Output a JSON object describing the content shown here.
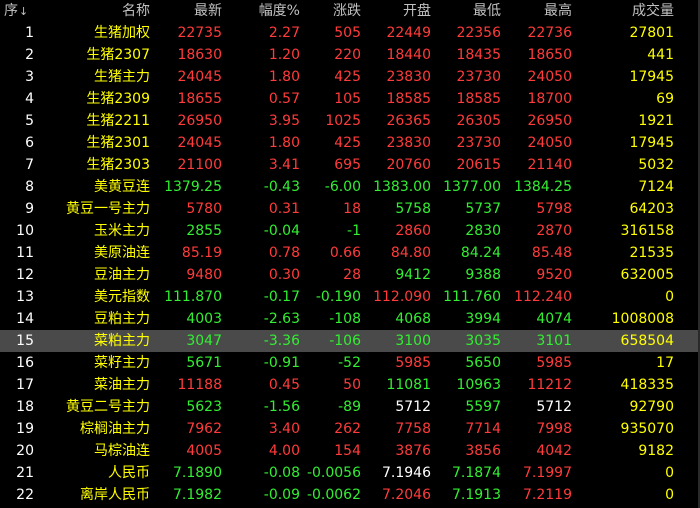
{
  "header": {
    "columns": [
      "序",
      "名称",
      "最新",
      "幅度%",
      "涨跌",
      "开盘",
      "最低",
      "最高",
      "成交量"
    ],
    "sort_arrow": "↓"
  },
  "colors": {
    "up": "#ff3b3b",
    "down": "#33ee33",
    "flat": "#ffffff",
    "name": "#ffff00",
    "volume": "#ffff00",
    "selected_row_bg": "#4a4a4a"
  },
  "selected_index": 14,
  "rows": [
    {
      "n": "1",
      "name": "生猪加权",
      "last": "22735",
      "pct": "2.27",
      "chg": "505",
      "open": "22449",
      "low": "22356",
      "high": "22736",
      "vol": "27801",
      "dir": {
        "last": "up",
        "pct": "up",
        "chg": "up",
        "open": "up",
        "low": "up",
        "high": "up"
      }
    },
    {
      "n": "2",
      "name": "生猪2307",
      "last": "18630",
      "pct": "1.20",
      "chg": "220",
      "open": "18440",
      "low": "18435",
      "high": "18650",
      "vol": "441",
      "dir": {
        "last": "up",
        "pct": "up",
        "chg": "up",
        "open": "up",
        "low": "up",
        "high": "up"
      }
    },
    {
      "n": "3",
      "name": "生猪主力",
      "last": "24045",
      "pct": "1.80",
      "chg": "425",
      "open": "23830",
      "low": "23730",
      "high": "24050",
      "vol": "17945",
      "dir": {
        "last": "up",
        "pct": "up",
        "chg": "up",
        "open": "up",
        "low": "up",
        "high": "up"
      }
    },
    {
      "n": "4",
      "name": "生猪2309",
      "last": "18655",
      "pct": "0.57",
      "chg": "105",
      "open": "18585",
      "low": "18585",
      "high": "18700",
      "vol": "69",
      "dir": {
        "last": "up",
        "pct": "up",
        "chg": "up",
        "open": "up",
        "low": "up",
        "high": "up"
      }
    },
    {
      "n": "5",
      "name": "生猪2211",
      "last": "26950",
      "pct": "3.95",
      "chg": "1025",
      "open": "26365",
      "low": "26305",
      "high": "26950",
      "vol": "1921",
      "dir": {
        "last": "up",
        "pct": "up",
        "chg": "up",
        "open": "up",
        "low": "up",
        "high": "up"
      }
    },
    {
      "n": "6",
      "name": "生猪2301",
      "last": "24045",
      "pct": "1.80",
      "chg": "425",
      "open": "23830",
      "low": "23730",
      "high": "24050",
      "vol": "17945",
      "dir": {
        "last": "up",
        "pct": "up",
        "chg": "up",
        "open": "up",
        "low": "up",
        "high": "up"
      }
    },
    {
      "n": "7",
      "name": "生猪2303",
      "last": "21100",
      "pct": "3.41",
      "chg": "695",
      "open": "20760",
      "low": "20615",
      "high": "21140",
      "vol": "5032",
      "dir": {
        "last": "up",
        "pct": "up",
        "chg": "up",
        "open": "up",
        "low": "up",
        "high": "up"
      }
    },
    {
      "n": "8",
      "name": "美黄豆连",
      "last": "1379.25",
      "pct": "-0.43",
      "chg": "-6.00",
      "open": "1383.00",
      "low": "1377.00",
      "high": "1384.25",
      "vol": "7124",
      "dir": {
        "last": "down",
        "pct": "down",
        "chg": "down",
        "open": "down",
        "low": "down",
        "high": "down"
      }
    },
    {
      "n": "9",
      "name": "黄豆一号主力",
      "last": "5780",
      "pct": "0.31",
      "chg": "18",
      "open": "5758",
      "low": "5737",
      "high": "5798",
      "vol": "64203",
      "dir": {
        "last": "up",
        "pct": "up",
        "chg": "up",
        "open": "down",
        "low": "down",
        "high": "up"
      }
    },
    {
      "n": "10",
      "name": "玉米主力",
      "last": "2855",
      "pct": "-0.04",
      "chg": "-1",
      "open": "2860",
      "low": "2830",
      "high": "2870",
      "vol": "316158",
      "dir": {
        "last": "down",
        "pct": "down",
        "chg": "down",
        "open": "up",
        "low": "down",
        "high": "up"
      }
    },
    {
      "n": "11",
      "name": "美原油连",
      "last": "85.19",
      "pct": "0.78",
      "chg": "0.66",
      "open": "84.80",
      "low": "84.24",
      "high": "85.48",
      "vol": "21535",
      "dir": {
        "last": "up",
        "pct": "up",
        "chg": "up",
        "open": "up",
        "low": "down",
        "high": "up"
      }
    },
    {
      "n": "12",
      "name": "豆油主力",
      "last": "9480",
      "pct": "0.30",
      "chg": "28",
      "open": "9412",
      "low": "9388",
      "high": "9520",
      "vol": "632005",
      "dir": {
        "last": "up",
        "pct": "up",
        "chg": "up",
        "open": "down",
        "low": "down",
        "high": "up"
      }
    },
    {
      "n": "13",
      "name": "美元指数",
      "last": "111.870",
      "pct": "-0.17",
      "chg": "-0.190",
      "open": "112.090",
      "low": "111.760",
      "high": "112.240",
      "vol": "0",
      "dir": {
        "last": "down",
        "pct": "down",
        "chg": "down",
        "open": "up",
        "low": "down",
        "high": "up"
      }
    },
    {
      "n": "14",
      "name": "豆粕主力",
      "last": "4003",
      "pct": "-2.63",
      "chg": "-108",
      "open": "4068",
      "low": "3994",
      "high": "4074",
      "vol": "1008008",
      "dir": {
        "last": "down",
        "pct": "down",
        "chg": "down",
        "open": "down",
        "low": "down",
        "high": "down"
      }
    },
    {
      "n": "15",
      "name": "菜粕主力",
      "last": "3047",
      "pct": "-3.36",
      "chg": "-106",
      "open": "3100",
      "low": "3035",
      "high": "3101",
      "vol": "658504",
      "dir": {
        "last": "down",
        "pct": "down",
        "chg": "down",
        "open": "down",
        "low": "down",
        "high": "down"
      }
    },
    {
      "n": "16",
      "name": "菜籽主力",
      "last": "5671",
      "pct": "-0.91",
      "chg": "-52",
      "open": "5985",
      "low": "5650",
      "high": "5985",
      "vol": "17",
      "dir": {
        "last": "down",
        "pct": "down",
        "chg": "down",
        "open": "up",
        "low": "down",
        "high": "up"
      }
    },
    {
      "n": "17",
      "name": "菜油主力",
      "last": "11188",
      "pct": "0.45",
      "chg": "50",
      "open": "11081",
      "low": "10963",
      "high": "11212",
      "vol": "418335",
      "dir": {
        "last": "up",
        "pct": "up",
        "chg": "up",
        "open": "down",
        "low": "down",
        "high": "up"
      }
    },
    {
      "n": "18",
      "name": "黄豆二号主力",
      "last": "5623",
      "pct": "-1.56",
      "chg": "-89",
      "open": "5712",
      "low": "5597",
      "high": "5712",
      "vol": "92790",
      "dir": {
        "last": "down",
        "pct": "down",
        "chg": "down",
        "open": "flat",
        "low": "down",
        "high": "flat"
      }
    },
    {
      "n": "19",
      "name": "棕榈油主力",
      "last": "7962",
      "pct": "3.40",
      "chg": "262",
      "open": "7758",
      "low": "7714",
      "high": "7998",
      "vol": "935070",
      "dir": {
        "last": "up",
        "pct": "up",
        "chg": "up",
        "open": "up",
        "low": "up",
        "high": "up"
      }
    },
    {
      "n": "20",
      "name": "马棕油连",
      "last": "4005",
      "pct": "4.00",
      "chg": "154",
      "open": "3876",
      "low": "3856",
      "high": "4042",
      "vol": "9182",
      "dir": {
        "last": "up",
        "pct": "up",
        "chg": "up",
        "open": "up",
        "low": "up",
        "high": "up"
      }
    },
    {
      "n": "21",
      "name": "人民币",
      "last": "7.1890",
      "pct": "-0.08",
      "chg": "-0.0056",
      "open": "7.1946",
      "low": "7.1874",
      "high": "7.1997",
      "vol": "0",
      "dir": {
        "last": "down",
        "pct": "down",
        "chg": "down",
        "open": "flat",
        "low": "down",
        "high": "up"
      }
    },
    {
      "n": "22",
      "name": "离岸人民币",
      "last": "7.1982",
      "pct": "-0.09",
      "chg": "-0.0062",
      "open": "7.2046",
      "low": "7.1913",
      "high": "7.2119",
      "vol": "0",
      "dir": {
        "last": "down",
        "pct": "down",
        "chg": "down",
        "open": "up",
        "low": "down",
        "high": "up"
      }
    }
  ]
}
